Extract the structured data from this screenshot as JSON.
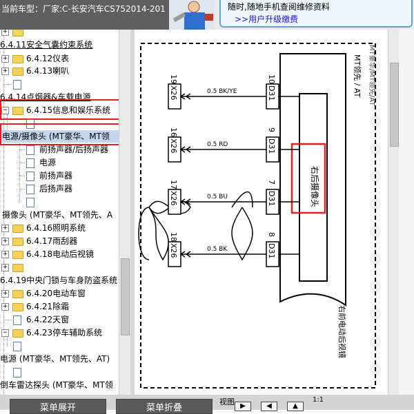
{
  "header": {
    "vehicle_label": "当前车型：厂家:C-长安汽车CS752014-201",
    "ad_line1": "随时,随地手机查阅维修资料",
    "ad_line2": ">>用户升级缴费"
  },
  "tree": {
    "items": [
      {
        "label": ""
      },
      {
        "label": "6.4.11安全气囊约束系统"
      },
      {
        "label": "6.4.12仪表"
      },
      {
        "label": "6.4.13喇叭"
      },
      {
        "label": ""
      },
      {
        "label": "6.4.14点烟器&车载电源"
      },
      {
        "label": "6.4.15信息和娱乐系统"
      },
      {
        "label": ""
      },
      {
        "label": "电源/摄像头 (MT豪华、MT领"
      },
      {
        "label": "前扬声器/后扬声器"
      },
      {
        "label": "电源"
      },
      {
        "label": "前扬声器"
      },
      {
        "label": "后扬声器"
      },
      {
        "label": ""
      },
      {
        "label": "摄像头 (MT豪华、MT领先、A"
      },
      {
        "label": "6.4.16照明系统"
      },
      {
        "label": "6.4.17雨刮器"
      },
      {
        "label": "6.4.18电动后视镜"
      },
      {
        "label": ""
      },
      {
        "label": "6.4.19中央门锁与车身防盗系统"
      },
      {
        "label": "6.4.20电动车窗"
      },
      {
        "label": "6.4.21除霜"
      },
      {
        "label": "6.4.22天窗"
      },
      {
        "label": "6.4.23停车辅助系统"
      },
      {
        "label": ""
      },
      {
        "label": "电源 (MT豪华、MT领先、AT)"
      },
      {
        "label": ""
      },
      {
        "label": "倒车雷达探头 (MT豪华、MT领"
      }
    ]
  },
  "diagram": {
    "header_label": "MT领先 / AT",
    "side_label_top": "MT豪华/MT领先/AT",
    "component_label": "右后摄像头",
    "mirror_label": "右前电动后视镜",
    "wires": [
      {
        "x_conn": "X26",
        "x_pin": "19",
        "color": "0.5 BK/YE",
        "d_conn": "D31",
        "d_pin": "10"
      },
      {
        "x_conn": "X26",
        "x_pin": "16",
        "color": "0.5 RD",
        "d_conn": "D31",
        "d_pin": "9"
      },
      {
        "x_conn": "X26",
        "x_pin": "17",
        "color": "0.5 BU",
        "d_conn": "D31",
        "d_pin": "7"
      },
      {
        "x_conn": "X26",
        "x_pin": "18",
        "color": "0.5 BK",
        "d_conn": "D31",
        "d_pin": "8"
      }
    ]
  },
  "bottom": {
    "expand_label": "菜单展开",
    "collapse_label": "菜单折叠",
    "view_label": "视图",
    "zoom_label": "1:1"
  },
  "colors": {
    "highlight_red": "#e02020",
    "selection": "#c3d6ee",
    "ad_border": "#59a5d8"
  }
}
